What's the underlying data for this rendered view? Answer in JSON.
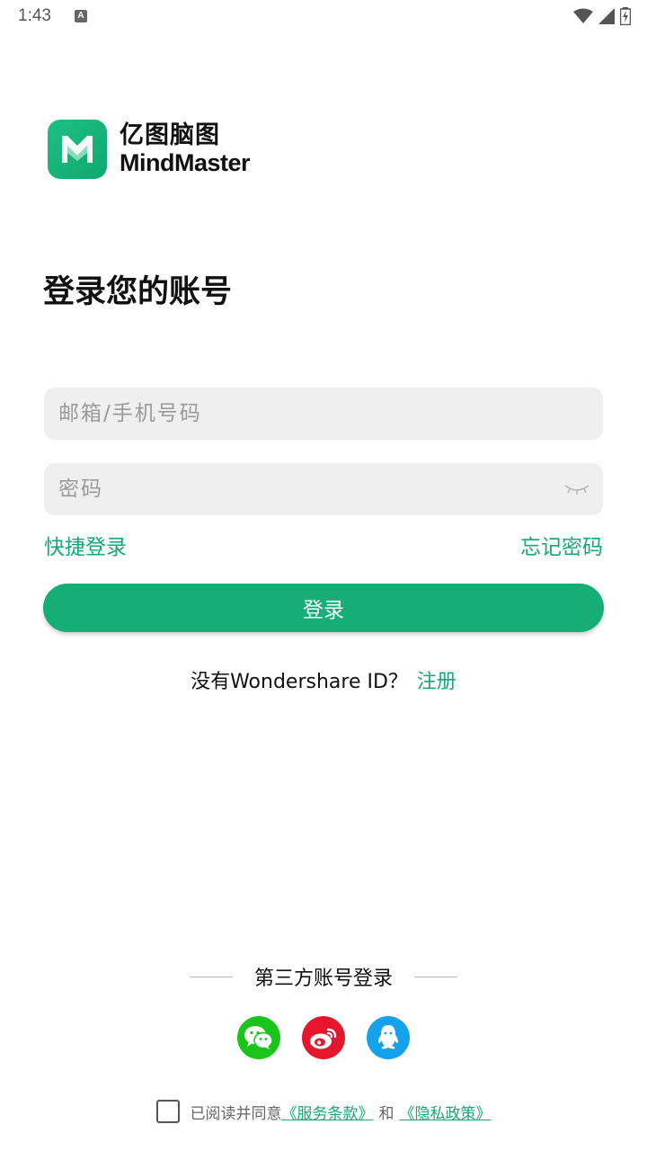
{
  "status_bar": {
    "time": "1:43",
    "notification_icon": "A"
  },
  "logo": {
    "name_cn": "亿图脑图",
    "name_en": "MindMaster"
  },
  "page_title": "登录您的账号",
  "form": {
    "email_placeholder": "邮箱/手机号码",
    "password_placeholder": "密码",
    "quick_login": "快捷登录",
    "forgot_password": "忘记密码",
    "login_button": "登录"
  },
  "register": {
    "prompt": "没有Wondershare ID？",
    "link": "注册"
  },
  "third_party": {
    "label": "第三方账号登录",
    "providers": [
      "wechat-icon",
      "weibo-icon",
      "qq-icon"
    ]
  },
  "agreement": {
    "text": "已阅读并同意",
    "terms": "《服务条款》",
    "and": "和",
    "privacy": "《隐私政策》"
  },
  "colors": {
    "accent": "#15ae77",
    "wechat": "#1ac41a",
    "weibo": "#e6162d",
    "qq": "#16a2eb"
  }
}
